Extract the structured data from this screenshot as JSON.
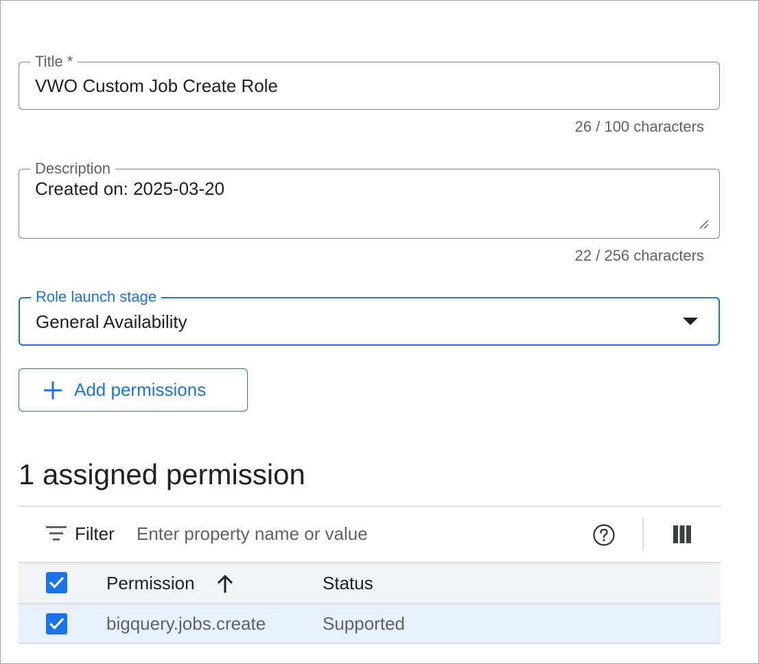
{
  "form": {
    "title": {
      "label": "Title *",
      "value": "VWO Custom Job Create Role",
      "counter": "26 / 100 characters"
    },
    "description": {
      "label": "Description",
      "value": "Created on: 2025-03-20",
      "counter": "22 / 256 characters"
    },
    "launch_stage": {
      "label": "Role launch stage",
      "selected": "General Availability"
    },
    "add_permissions_label": "Add permissions"
  },
  "permissions": {
    "heading": "1 assigned permission",
    "filter": {
      "label": "Filter",
      "placeholder": "Enter property name or value"
    },
    "columns": [
      "Permission",
      "Status"
    ],
    "rows": [
      {
        "permission": "bigquery.jobs.create",
        "status": "Supported",
        "checked": true
      }
    ],
    "sort": {
      "column": "Permission",
      "direction": "ascending"
    }
  },
  "colors": {
    "accent": "#1a73e8",
    "selected_row": "#e8f0fe",
    "header_row": "#f1f3f4"
  },
  "icons": [
    "plus-icon",
    "filter-icon",
    "help-icon",
    "columns-icon",
    "sort-ascending-icon",
    "checkbox-checked-icon",
    "dropdown-arrow-icon",
    "resize-grip-icon"
  ]
}
